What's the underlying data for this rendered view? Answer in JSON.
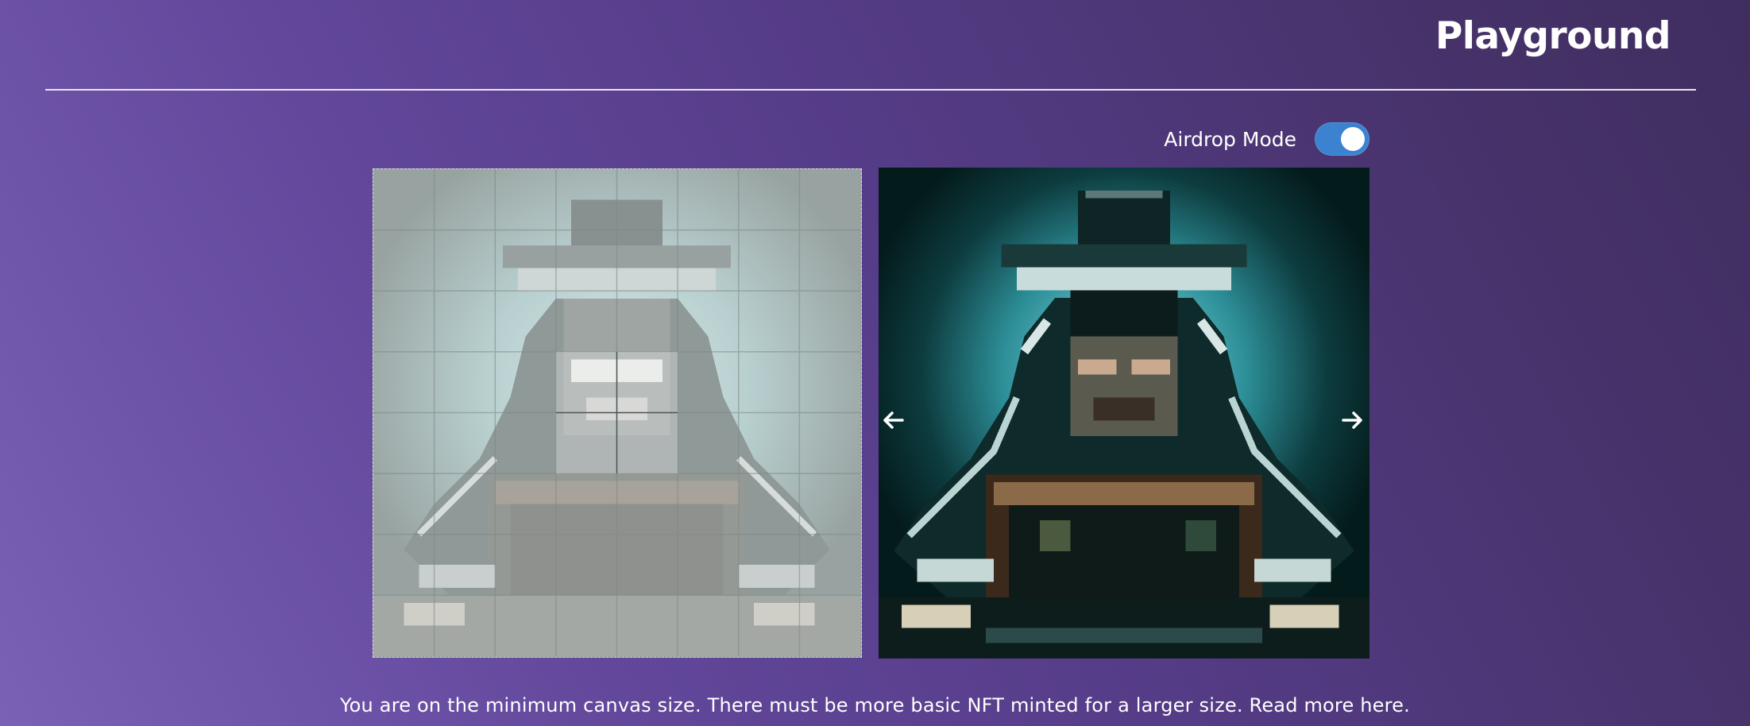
{
  "header": {
    "title": "Playground"
  },
  "controls": {
    "airdrop_label": "Airdrop Mode",
    "airdrop_enabled": true,
    "toggle_color": "#3b82d0"
  },
  "canvas": {
    "grid_columns": 8,
    "grid_rows": 8,
    "highlighted_cells": [
      [
        3,
        3
      ],
      [
        4,
        3
      ],
      [
        3,
        4
      ],
      [
        4,
        4
      ]
    ],
    "image_subject": "hooded hacker in fedora with laptop (pixel art)"
  },
  "preview": {
    "prev_icon": "arrow-left-icon",
    "next_icon": "arrow-right-icon"
  },
  "footer": {
    "note_text": "You are on the minimum canvas size. There must be more basic NFT minted for a larger size.",
    "read_more_label": "Read more here."
  },
  "colors": {
    "background_start": "#7a61b6",
    "background_end": "#3f2e60",
    "divider": "#e9e4f3"
  }
}
